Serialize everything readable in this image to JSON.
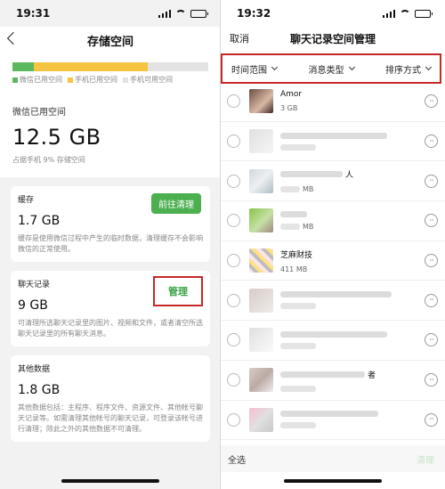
{
  "left": {
    "status_time": "19:31",
    "title": "存储空间",
    "storage_bar": {
      "wechat_fraction": 0.11,
      "phone_fraction": 0.58,
      "free_fraction": 0.31,
      "colors": {
        "wechat": "#5cb85c",
        "phone": "#f5c542",
        "free": "#e3e3e3"
      }
    },
    "legend": [
      "微信已用空间",
      "手机已用空间",
      "手机可用空间"
    ],
    "used_label": "微信已用空间",
    "used_value": "12.5 GB",
    "used_sub": "占据手机 9% 存储空间",
    "cache": {
      "title": "缓存",
      "value": "1.7 GB",
      "desc": "缓存是使用微信过程中产生的临时数据，清理缓存不会影响微信的正常使用。",
      "button": "前往清理"
    },
    "chat": {
      "title": "聊天记录",
      "value": "9 GB",
      "desc": "可清理所选聊天记录里的图片、视频和文件，或者清空所选聊天记录里的所有聊天消息。",
      "button": "管理"
    },
    "other": {
      "title": "其他数据",
      "value": "1.8 GB",
      "desc": "其他数据包括：主程序、程序文件、资源文件、其他帐号聊天记录等。如需清理其他帐号的聊天记录，可登录该帐号进行清理；除此之外的其他数据不可清理。"
    }
  },
  "right": {
    "status_time": "19:32",
    "cancel": "取消",
    "title": "聊天记录空间管理",
    "filters": [
      "时间范围",
      "消息类型",
      "排序方式"
    ],
    "rows": [
      {
        "name": "Amor",
        "size": "3 GB"
      },
      {
        "name": "",
        "size": ""
      },
      {
        "name": "人",
        "size": "MB"
      },
      {
        "name": "",
        "size": "MB"
      },
      {
        "name": "芝麻财技",
        "size": "411 MB"
      },
      {
        "name": "",
        "size": ""
      },
      {
        "name": "",
        "size": ""
      },
      {
        "name": "者",
        "size": ""
      },
      {
        "name": "",
        "size": ""
      }
    ],
    "more_glyph": "···",
    "select_all": "全选",
    "clean": "清理"
  }
}
